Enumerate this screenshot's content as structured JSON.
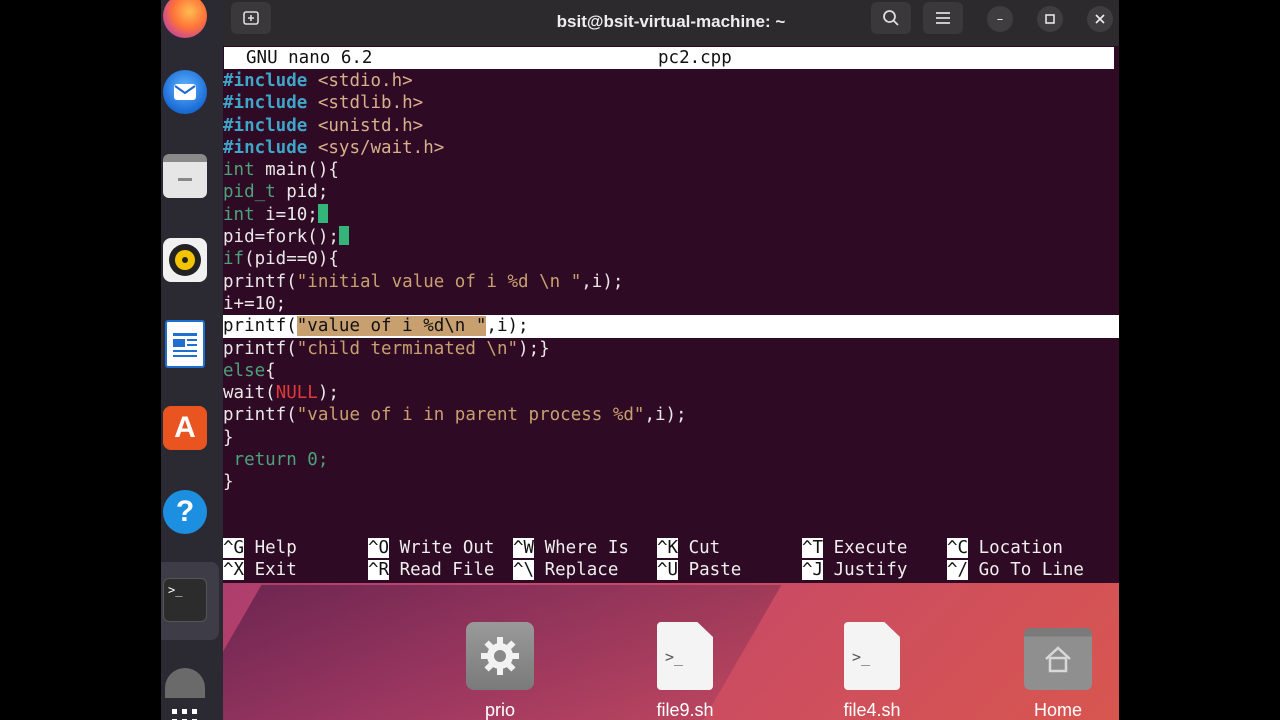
{
  "window": {
    "title": "bsit@bsit-virtual-machine: ~",
    "new_tab_icon": "new-tab-icon",
    "controls": [
      "search-icon",
      "hamburger-menu-icon",
      "minimize-icon",
      "maximize-icon",
      "close-icon"
    ]
  },
  "nano": {
    "version": "GNU nano 6.2",
    "filename": "pc2.cpp",
    "code": {
      "l1": {
        "pp": "#include",
        "rest": " <stdio.h>"
      },
      "l2": {
        "pp": "#include",
        "rest": " <stdlib.h>"
      },
      "l3": {
        "pp": "#include",
        "rest": " <unistd.h>"
      },
      "l4": {
        "pp": "#include",
        "rest": " <sys/wait.h>"
      },
      "l5": {
        "kw": "int",
        "rest": " main(){"
      },
      "l6": {
        "kw": "pid_t",
        "rest": " pid;"
      },
      "l7": {
        "kw": "int",
        "rest": " i=10;"
      },
      "l8": {
        "text": "pid=fork();"
      },
      "l9": {
        "kw": "if",
        "rest": "(pid==0){"
      },
      "l10": {
        "pre": "printf(",
        "str": "\"initial value of i %d \\n \"",
        "post": ",i);"
      },
      "l11": {
        "text": "i+=10;"
      },
      "l12": {
        "p": "p",
        "pre": "rintf(",
        "str": "\"value of i %d\\n \"",
        "post": ",i);"
      },
      "l13": {
        "pre": "printf(",
        "str": "\"child terminated \\n\"",
        "post": ");}"
      },
      "l14": {
        "kw": "else",
        "rest": "{"
      },
      "l15": {
        "pre": "wait(",
        "nul": "NULL",
        "post": ");"
      },
      "l16": {
        "pre": "printf(",
        "str": "\"value of i in parent process %d\"",
        "post": ",i);"
      },
      "l17": {
        "text": "}"
      },
      "l18": {
        "text": " return 0;"
      },
      "l19": {
        "text": "}"
      }
    },
    "shortcuts": [
      {
        "key": "^G",
        "label": " Help"
      },
      {
        "key": "^O",
        "label": " Write Out"
      },
      {
        "key": "^W",
        "label": " Where Is"
      },
      {
        "key": "^K",
        "label": " Cut"
      },
      {
        "key": "^T",
        "label": " Execute"
      },
      {
        "key": "^C",
        "label": " Location"
      },
      {
        "key": "^X",
        "label": " Exit"
      },
      {
        "key": "^R",
        "label": " Read File"
      },
      {
        "key": "^\\",
        "label": " Replace"
      },
      {
        "key": "^U",
        "label": " Paste"
      },
      {
        "key": "^J",
        "label": " Justify"
      },
      {
        "key": "^/",
        "label": " Go To Line"
      }
    ]
  },
  "dock": {
    "items": [
      "firefox-icon",
      "thunderbird-icon",
      "files-icon",
      "rhythmbox-icon",
      "libreoffice-writer-icon",
      "app-center-icon",
      "help-icon",
      "terminal-icon",
      "trash-icon",
      "show-apps-icon"
    ]
  },
  "desktop": {
    "files": [
      {
        "name": "prio",
        "icon": "settings-gear-icon"
      },
      {
        "name": "file9.sh",
        "icon": "script-file-icon"
      },
      {
        "name": "file4.sh",
        "icon": "script-file-icon"
      },
      {
        "name": "Home",
        "icon": "home-folder-icon"
      }
    ]
  },
  "colors": {
    "terminal_bg": "#2f0a24",
    "preprocessor": "#3ea6c8",
    "keyword": "#4aa37a",
    "string": "#c8a070",
    "null": "#e03a3a",
    "cursor": "#33b57a"
  }
}
